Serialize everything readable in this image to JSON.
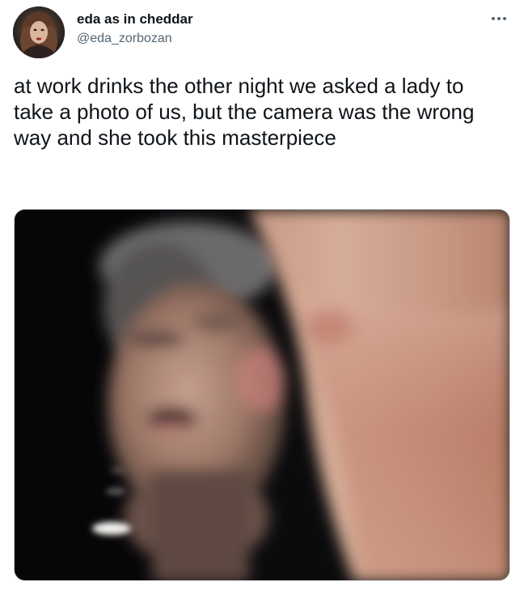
{
  "tweet": {
    "author": {
      "display_name": "eda as in cheddar",
      "handle": "@eda_zorbozan",
      "avatar_icon": "profile-photo"
    },
    "more_icon": "more-horizontal-icon",
    "text": "at work drinks the other night we asked a lady to take a photo of us, but the camera was the wrong way and she took this masterpiece",
    "media": {
      "type": "photo",
      "icon": "blurry-photo"
    }
  },
  "colors": {
    "text_primary": "#0f1419",
    "text_secondary": "#536471",
    "border": "#cfd9de"
  }
}
